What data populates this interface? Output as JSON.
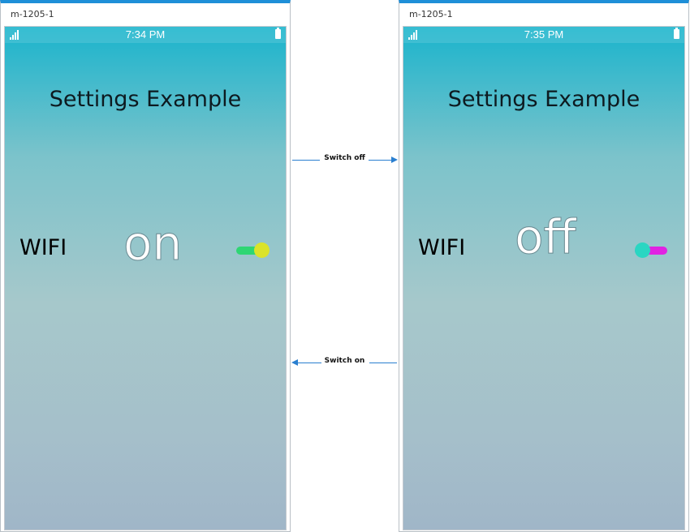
{
  "colors": {
    "window_accent": "#1e8fd8",
    "toggle_on_track": "#2ed673",
    "toggle_on_knob": "#dbe32a",
    "toggle_off_track": "#e023e2",
    "toggle_off_knob": "#2ad6c2",
    "arrow": "#2a7fd0"
  },
  "left_window": {
    "title": "m-1205-1",
    "status_time": "7:34 PM",
    "app_title": "Settings Example",
    "setting_label": "WIFI",
    "state_text": "on",
    "toggle_state": "on",
    "icons": [
      "signal-icon",
      "battery-icon"
    ]
  },
  "right_window": {
    "title": "m-1205-1",
    "status_time": "7:35 PM",
    "app_title": "Settings Example",
    "setting_label": "WIFI",
    "state_text": "off",
    "toggle_state": "off",
    "icons": [
      "signal-icon",
      "battery-icon"
    ]
  },
  "transitions": {
    "switch_off": "Switch off",
    "switch_on": "Switch on"
  }
}
